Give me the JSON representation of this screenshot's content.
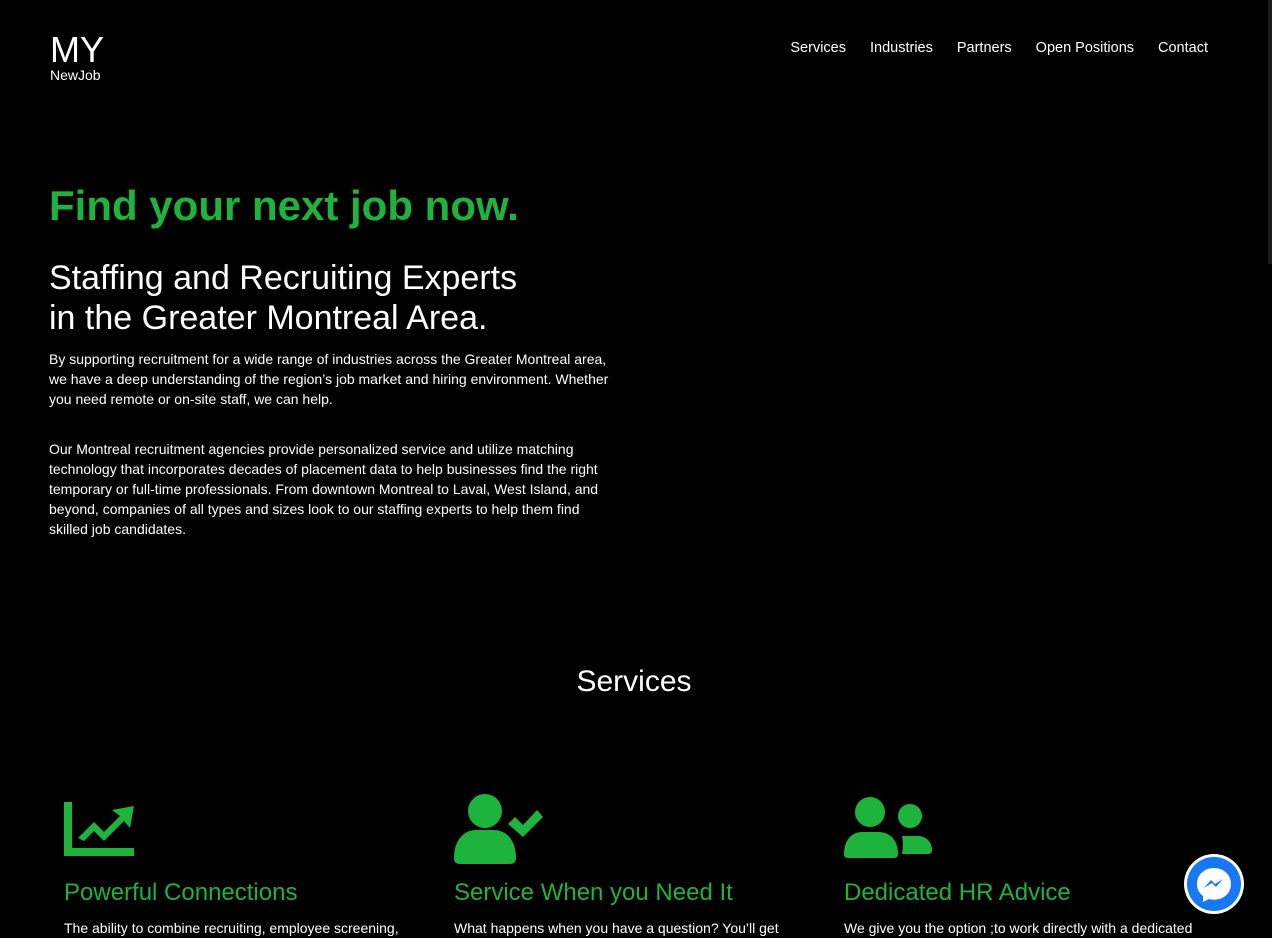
{
  "header": {
    "logo_main": "MY",
    "logo_sub": "NewJob",
    "nav": [
      "Services",
      "Industries",
      "Partners",
      "Open Positions",
      "Contact"
    ]
  },
  "hero": {
    "headline": "Find your next job now.",
    "subtitle_line1": "Staffing and Recruiting Experts",
    "subtitle_line2": "in the Greater Montreal Area.",
    "paragraph1": "By supporting recruitment for a wide range of industries across the Greater Montreal area, we have a deep understanding of the region’s job market and hiring environment. Whether you need remote or on-site staff, we can help.",
    "paragraph2": "Our Montreal recruitment agencies provide personalized service and utilize matching technology that incorporates decades of placement data to help businesses find the right temporary or full-time professionals. From downtown Montreal to Laval, West Island, and beyond, companies of all types and sizes look to our staffing experts to help them find skilled job candidates."
  },
  "services": {
    "title": "Services",
    "cards": [
      {
        "icon": "chart-line-icon",
        "title": "Powerful Connections",
        "text": "The ability to combine recruiting, employee screening,"
      },
      {
        "icon": "user-check-icon",
        "title": "Service When you Need It",
        "text": "What happens when you have a question? You’ll get"
      },
      {
        "icon": "users-icon",
        "title": "Dedicated HR Advice",
        "text": "We give you the option ;to work directly with a dedicated"
      }
    ]
  },
  "colors": {
    "accent": "#1db33d",
    "background": "#000000",
    "text": "#ffffff",
    "messenger": "#1877f2"
  },
  "widgets": {
    "messenger_icon": "messenger-icon"
  }
}
